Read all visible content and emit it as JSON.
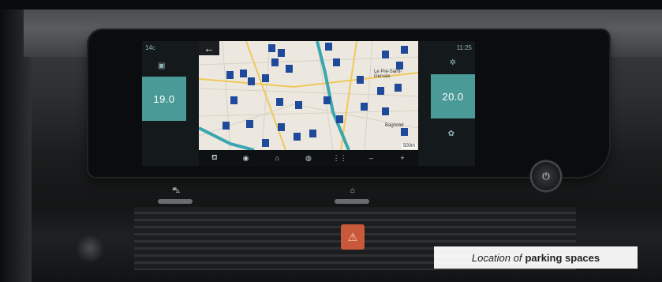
{
  "screen": {
    "outside_temp": "14c",
    "clock": "11:25",
    "left_temp": "19.0",
    "right_temp": "20.0",
    "back_icon": "arrow-left-icon",
    "scale_label": "500m",
    "map_labels": [
      "Le Pré-Saint-Gervais",
      "Bagnolet"
    ],
    "bottom_bar": [
      {
        "name": "parking-icon",
        "glyph": "⛾"
      },
      {
        "name": "nav-icon",
        "glyph": "◉"
      },
      {
        "name": "home-icon",
        "glyph": "⌂"
      },
      {
        "name": "media-icon",
        "glyph": "◍"
      },
      {
        "name": "fan-icon",
        "glyph": "⋮⋮"
      },
      {
        "name": "minus-label",
        "glyph": "–"
      },
      {
        "name": "plus-label",
        "glyph": "+"
      }
    ]
  },
  "caption": {
    "prefix": "Location of",
    "emphasis": "parking spaces"
  },
  "colors": {
    "accent": "#4a9a98",
    "parking_pin": "#1f4a9c",
    "route": "#3aa6b0"
  }
}
